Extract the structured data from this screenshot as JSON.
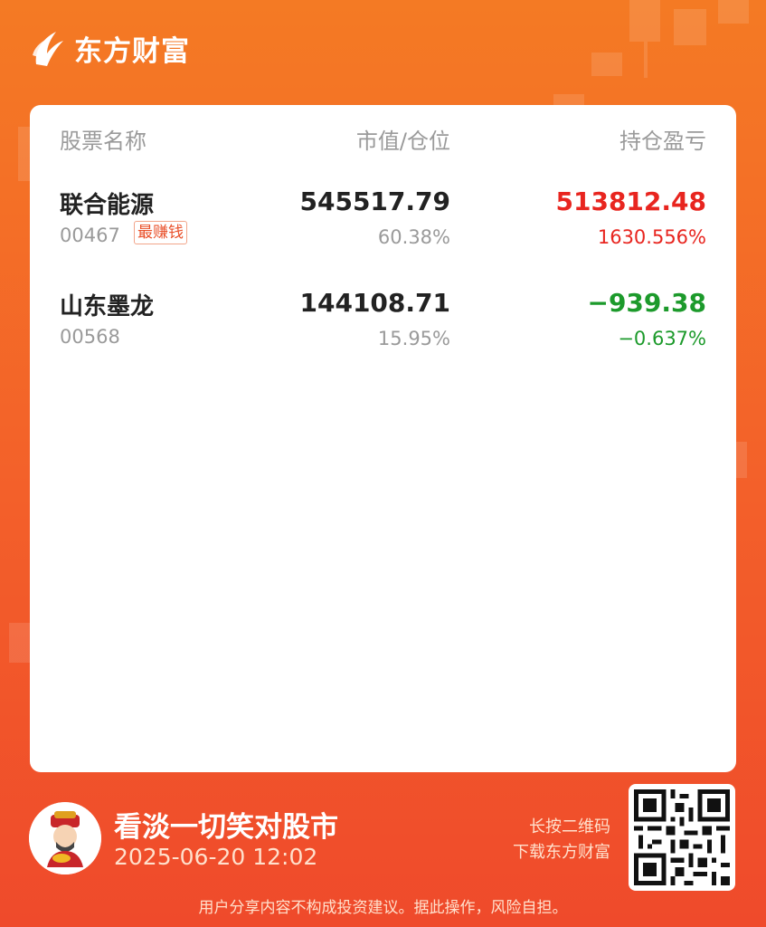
{
  "brand": {
    "name": "东方财富",
    "logo_icon": "eastmoney-logo-icon"
  },
  "table": {
    "headers": {
      "name": "股票名称",
      "value": "市值/仓位",
      "pl": "持仓盈亏"
    },
    "rows": [
      {
        "name": "联合能源",
        "code": "00467",
        "badge": "最赚钱",
        "value": "545517.79",
        "position": "60.38%",
        "pl": "513812.48",
        "pl_pct": "1630.556%",
        "direction": "up"
      },
      {
        "name": "山东墨龙",
        "code": "00568",
        "badge": "",
        "value": "144108.71",
        "position": "15.95%",
        "pl": "−939.38",
        "pl_pct": "−0.637%",
        "direction": "down"
      }
    ]
  },
  "footer": {
    "slogan": "看淡一切笑对股市",
    "datetime": "2025-06-20 12:02",
    "qr_tip_line1": "长按二维码",
    "qr_tip_line2": "下载东方财富",
    "disclaimer": "用户分享内容不构成投资建议。据此操作，风险自担。"
  },
  "colors": {
    "up": "#e8251f",
    "down": "#1c9a2b",
    "accent": "#f36a27"
  }
}
